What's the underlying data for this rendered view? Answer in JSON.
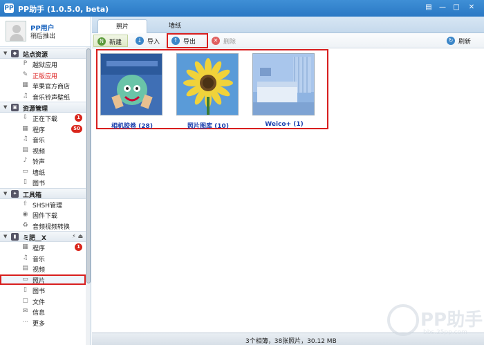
{
  "window": {
    "title": "PP助手 (1.0.5.0, beta)",
    "logo_text": "PP",
    "buttons": {
      "menu": "▤",
      "minimize": "—",
      "maximize": "□",
      "close": "✕"
    }
  },
  "user": {
    "name": "PP用户",
    "action": "稍后推出"
  },
  "sidebar": {
    "sections": [
      {
        "label": "站点资源",
        "items": [
          {
            "label": "越狱应用",
            "icon": "P"
          },
          {
            "label": "正版应用",
            "icon": "✎",
            "red": true
          },
          {
            "label": "苹果官方商店",
            "icon": "▦"
          },
          {
            "label": "音乐铃声壁纸",
            "icon": "♫"
          }
        ]
      },
      {
        "label": "资源管理",
        "items": [
          {
            "label": "正在下载",
            "icon": "⇩",
            "badge": "1"
          },
          {
            "label": "程序",
            "icon": "▦",
            "badge": "50"
          },
          {
            "label": "音乐",
            "icon": "♫"
          },
          {
            "label": "视频",
            "icon": "▤"
          },
          {
            "label": "铃声",
            "icon": "♪"
          },
          {
            "label": "墙纸",
            "icon": "▭"
          },
          {
            "label": "图书",
            "icon": "▯"
          }
        ]
      },
      {
        "label": "工具箱",
        "items": [
          {
            "label": "SHSH管理",
            "icon": "⇧"
          },
          {
            "label": "固件下载",
            "icon": "◉"
          },
          {
            "label": "音频视频转换",
            "icon": "♻"
          }
        ]
      },
      {
        "label": "ミ肥__X",
        "tools": "⚡ ⏏",
        "items": [
          {
            "label": "程序",
            "icon": "▦",
            "badge": "1"
          },
          {
            "label": "音乐",
            "icon": "♫"
          },
          {
            "label": "视频",
            "icon": "▤"
          },
          {
            "label": "照片",
            "icon": "▭",
            "selected": true
          },
          {
            "label": "图书",
            "icon": "▯"
          },
          {
            "label": "文件",
            "icon": "▢"
          },
          {
            "label": "信息",
            "icon": "✉"
          },
          {
            "label": "更多",
            "icon": "···"
          }
        ]
      }
    ]
  },
  "tabs": [
    {
      "label": "照片",
      "active": true
    },
    {
      "label": "墙纸",
      "active": false
    }
  ],
  "toolbar": {
    "new_label": "新建",
    "import_label": "导入",
    "export_label": "导出",
    "delete_label": "删除",
    "refresh_label": "刷新"
  },
  "albums": [
    {
      "label": "相机胶卷 (28)",
      "kind": "cartoon"
    },
    {
      "label": "照片图库 (10)",
      "kind": "sunflower"
    },
    {
      "label": "Weico+ (1)",
      "kind": "room"
    }
  ],
  "status": {
    "text": "3个相簿，38张照片，30.12 MB"
  },
  "watermark": {
    "text": "PP助手",
    "url": "bbs.25pp.com"
  },
  "colors": {
    "accent": "#2a78c4",
    "highlight": "#d81e1e",
    "link": "#1a3fae"
  }
}
